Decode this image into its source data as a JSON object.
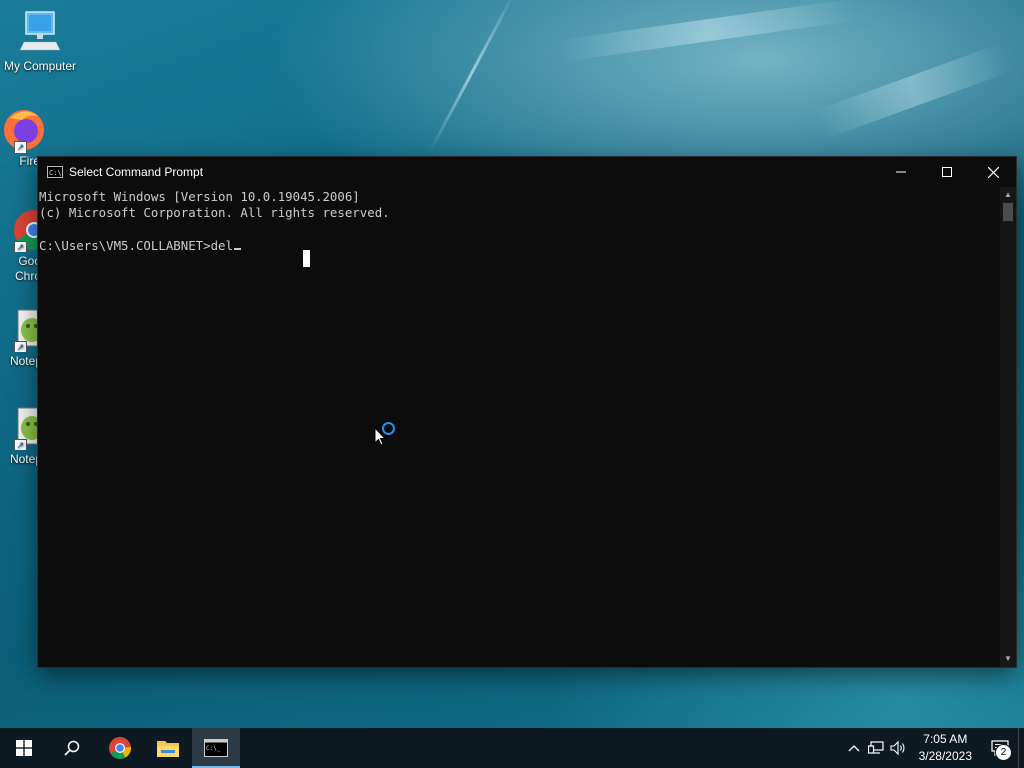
{
  "desktop": {
    "icons": [
      {
        "label": "My Computer"
      },
      {
        "label": "Fire"
      },
      {
        "label": "Goo\nChro"
      },
      {
        "label": "Notep"
      },
      {
        "label": "Notep"
      }
    ]
  },
  "window": {
    "title": "Select Command Prompt",
    "icon_text": "C:\\",
    "console_lines": [
      "Microsoft Windows [Version 10.0.19045.2006]",
      "(c) Microsoft Corporation. All rights reserved.",
      "",
      "C:\\Users\\VM5.COLLABNET>del"
    ]
  },
  "taskbar": {
    "clock_time": "7:05 AM",
    "clock_date": "3/28/2023",
    "notification_count": "2",
    "colors": {
      "background": "#0e1a22",
      "active_indicator": "#76b9ed"
    }
  }
}
